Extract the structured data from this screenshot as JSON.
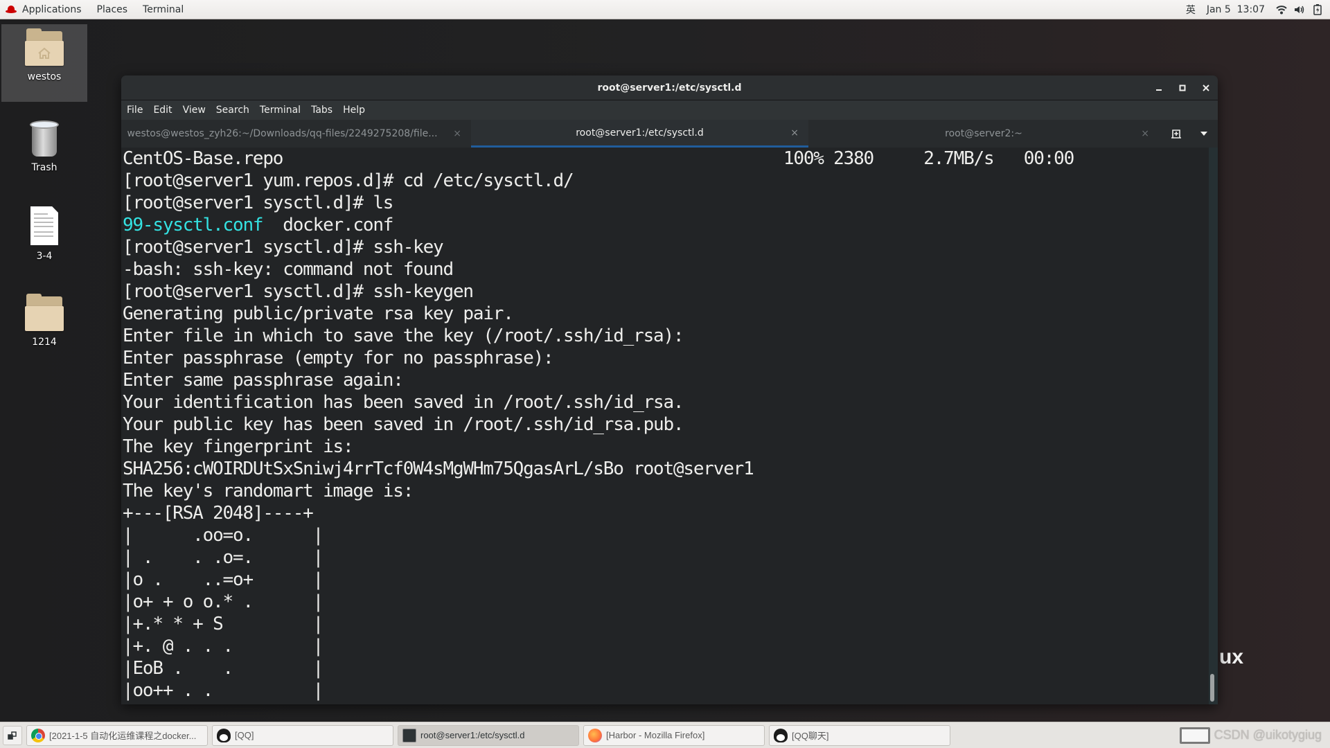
{
  "topbar": {
    "menu": [
      "Applications",
      "Places",
      "Terminal"
    ],
    "input_method": "英",
    "datetime": "Jan 5  13:07",
    "icons": [
      "wifi-icon",
      "volume-icon",
      "battery-icon"
    ]
  },
  "desktop": {
    "icons": [
      {
        "label": "westos",
        "type": "home-folder",
        "selected": true
      },
      {
        "label": "Trash",
        "type": "trash"
      },
      {
        "label": "3-4",
        "type": "document"
      },
      {
        "label": "1214",
        "type": "folder"
      }
    ],
    "background_text": "ux"
  },
  "window": {
    "title": "root@server1:/etc/sysctl.d",
    "controls": {
      "minimize": "_",
      "maximize": "□",
      "close": "✕"
    },
    "menu": [
      "File",
      "Edit",
      "View",
      "Search",
      "Terminal",
      "Tabs",
      "Help"
    ],
    "tabs": [
      {
        "label": "westos@westos_zyh26:~/Downloads/qq-files/2249275208/file...",
        "active": false
      },
      {
        "label": "root@server1:/etc/sysctl.d",
        "active": true
      },
      {
        "label": "root@server2:~",
        "active": false
      }
    ],
    "tab_close": "×",
    "new_tab_icon": "new-tab-icon",
    "tab_menu_icon": "dropdown-icon"
  },
  "terminal": {
    "lines": [
      {
        "text": "CentOS-Base.repo                                                  100% 2380     2.7MB/s   00:00"
      },
      {
        "text": "[root@server1 yum.repos.d]# cd /etc/sysctl.d/"
      },
      {
        "text": "[root@server1 sysctl.d]# ls"
      },
      {
        "parts": [
          {
            "text": "99-sysctl.conf",
            "color": "#34e2e2"
          },
          {
            "text": "  docker.conf"
          }
        ]
      },
      {
        "text": "[root@server1 sysctl.d]# ssh-key"
      },
      {
        "text": "-bash: ssh-key: command not found"
      },
      {
        "text": "[root@server1 sysctl.d]# ssh-keygen"
      },
      {
        "text": "Generating public/private rsa key pair."
      },
      {
        "text": "Enter file in which to save the key (/root/.ssh/id_rsa):"
      },
      {
        "text": "Enter passphrase (empty for no passphrase):"
      },
      {
        "text": "Enter same passphrase again:"
      },
      {
        "text": "Your identification has been saved in /root/.ssh/id_rsa."
      },
      {
        "text": "Your public key has been saved in /root/.ssh/id_rsa.pub."
      },
      {
        "text": "The key fingerprint is:"
      },
      {
        "text": "SHA256:cWOIRDUtSxSniwj4rrTcf0W4sMgWHm75QgasArL/sBo root@server1"
      },
      {
        "text": "The key's randomart image is:"
      },
      {
        "text": "+---[RSA 2048]----+"
      },
      {
        "text": "|      .oo=o.      |"
      },
      {
        "text": "| .    . .o=.      |"
      },
      {
        "text": "|o .    ..=o+      |"
      },
      {
        "text": "|o+ + o o.* .      |"
      },
      {
        "text": "|+.* * + S         |"
      },
      {
        "text": "|+. @ . . .        |"
      },
      {
        "text": "|EoB .    .        |"
      },
      {
        "text": "|oo++ . .          |"
      }
    ]
  },
  "taskbar": {
    "tasks": [
      {
        "label": "[2021-1-5 自动化运维课程之docker...",
        "icon": "chrome-icon",
        "active": false
      },
      {
        "label": "[QQ]",
        "icon": "qq-icon",
        "active": false
      },
      {
        "label": "root@server1:/etc/sysctl.d",
        "icon": "terminal-icon",
        "active": true
      },
      {
        "label": "[Harbor - Mozilla Firefox]",
        "icon": "firefox-icon",
        "active": false
      },
      {
        "label": "[QQ聊天]",
        "icon": "qq-icon",
        "active": false
      }
    ],
    "watermark": "CSDN @uikotygiug"
  },
  "colors": {
    "terminal_bg": "#222426",
    "terminal_fg": "#eeeeec",
    "ls_highlight": "#34e2e2",
    "active_tab_accent": "#215d9c"
  }
}
